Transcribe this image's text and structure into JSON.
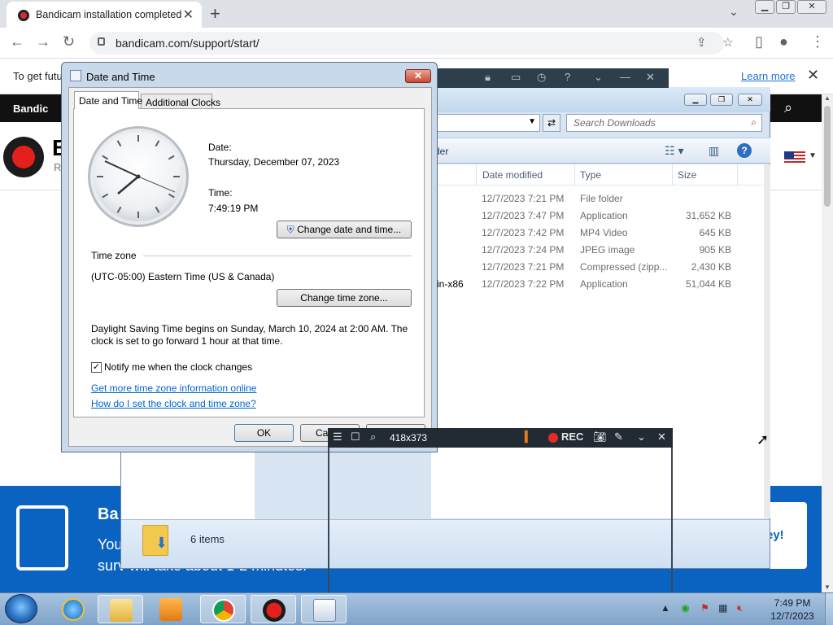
{
  "browser": {
    "tab_title": "Bandicam installation completed",
    "new_tab": "+",
    "url": "bandicam.com/support/start/",
    "tab_search": "⌄"
  },
  "infobar": {
    "text": "To get futu",
    "learn_more": "Learn more"
  },
  "page": {
    "nav_brand": "Bandic",
    "header_letter": "B",
    "header_sub": "R",
    "banner_title": "Ba",
    "banner_line1": "You",
    "banner_line2": "surv  will take about 1-2 minutes.",
    "banner_cta": "ey!"
  },
  "bandicam_strip_icons": [
    "lock-icon",
    "folder-icon",
    "history-icon",
    "help-icon",
    "minimize-icon",
    "minimize-icon",
    "close-icon"
  ],
  "explorer": {
    "search_placeholder": "Search Downloads",
    "cmd_label": "der",
    "columns": [
      "Date modified",
      "Type",
      "Size"
    ],
    "rows": [
      {
        "name": "",
        "date": "12/7/2023 7:21 PM",
        "type": "File folder",
        "size": ""
      },
      {
        "name": "",
        "date": "12/7/2023 7:47 PM",
        "type": "Application",
        "size": "31,652 KB"
      },
      {
        "name": "",
        "date": "12/7/2023 7:42 PM",
        "type": "MP4 Video",
        "size": "645 KB"
      },
      {
        "name": "",
        "date": "12/7/2023 7:24 PM",
        "type": "JPEG image",
        "size": "905 KB"
      },
      {
        "name": "",
        "date": "12/7/2023 7:21 PM",
        "type": "Compressed (zipp...",
        "size": "2,430 KB"
      },
      {
        "name": "in-x86",
        "date": "12/7/2023 7:22 PM",
        "type": "Application",
        "size": "51,044 KB"
      }
    ],
    "status_items": "6 items"
  },
  "dialog": {
    "title": "Date and Time",
    "tab_active": "Date and Time",
    "tab_inactive": "Additional Clocks",
    "date_label": "Date:",
    "date_value": "Thursday, December 07, 2023",
    "time_label": "Time:",
    "time_value": "7:49:19 PM",
    "change_datetime": "Change date and time...",
    "timezone_heading": "Time zone",
    "timezone_value": "(UTC-05:00) Eastern Time (US & Canada)",
    "change_timezone": "Change time zone...",
    "dst_line1": "Daylight Saving Time begins on Sunday, March 10, 2024 at 2:00 AM. The",
    "dst_line2": "clock is set to go forward 1 hour at that time.",
    "notify_label": "Notify me when the clock changes",
    "notify_checked": "✓",
    "link1": "Get more time zone information online",
    "link2": "How do I set the clock and time zone?",
    "ok": "OK",
    "cancel": "Ca",
    "close_glyph": "✕"
  },
  "bandicam_toolbar": {
    "size": "418x373",
    "rec": "REC"
  },
  "taskbar": {
    "time": "7:49 PM",
    "date": "12/7/2023"
  }
}
